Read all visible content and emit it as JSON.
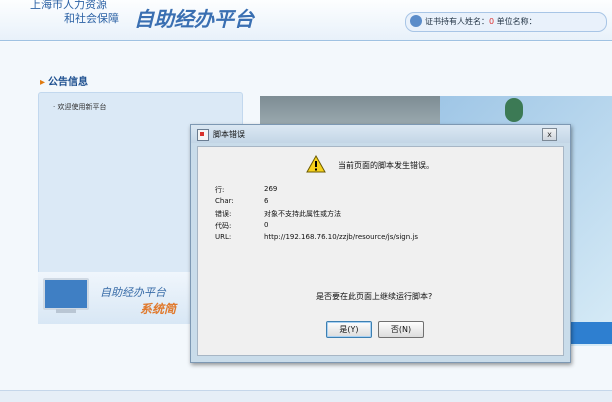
{
  "header": {
    "org_line1": "上海市人力资源",
    "org_line2": "和社会保障",
    "title": "自助经办平台",
    "user_label": "证书持有人姓名：",
    "user_value": "0",
    "unit_label": "单位名称：",
    "unit_value": ""
  },
  "notice": {
    "heading": "公告信息",
    "items": [
      "· 欢迎使用新平台"
    ]
  },
  "promo": {
    "line1": "自助经办平台",
    "line2": "系统简"
  },
  "dialog": {
    "title": "脚本错误",
    "close_glyph": "x",
    "message": "当前页面的脚本发生错误。",
    "details": [
      {
        "label": "行:",
        "value": "269"
      },
      {
        "label": "Char:",
        "value": "6"
      },
      {
        "label": "错误:",
        "value": "对象不支持此属性或方法"
      },
      {
        "label": "代码:",
        "value": "0"
      },
      {
        "label": "URL:",
        "value": "http://192.168.76.10/zzjb/resource/js/sign.js"
      }
    ],
    "question": "是否要在此页面上继续运行脚本?",
    "yes_label": "是(Y)",
    "no_label": "否(N)"
  },
  "colors": {
    "brand": "#3a6fb2",
    "accent": "#e07a2e"
  }
}
